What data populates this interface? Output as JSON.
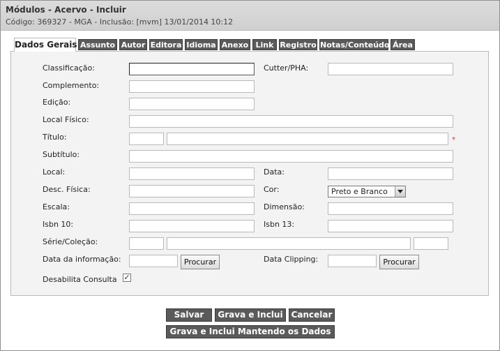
{
  "header": {
    "title": "Módulos - Acervo - Incluir",
    "subtitle": "Código: 369327 - MGA - Inclusão: [mvm] 13/01/2014 10:12"
  },
  "tabs": [
    {
      "label": "Dados Gerais",
      "active": true
    },
    {
      "label": "Assunto"
    },
    {
      "label": "Autor"
    },
    {
      "label": "Editora"
    },
    {
      "label": "Idioma"
    },
    {
      "label": "Anexo"
    },
    {
      "label": "Link"
    },
    {
      "label": "Registro"
    },
    {
      "label": "Notas/Conteúdo"
    },
    {
      "label": "Área"
    }
  ],
  "form": {
    "classificacao": {
      "label": "Classificação:",
      "value": ""
    },
    "cutter": {
      "label": "Cutter/PHA:",
      "value": ""
    },
    "complemento": {
      "label": "Complemento:",
      "value": ""
    },
    "edicao": {
      "label": "Edição:",
      "value": ""
    },
    "local_fisico": {
      "label": "Local Físico:",
      "value": ""
    },
    "titulo": {
      "label": "Título:",
      "value_prefix": "",
      "value": "",
      "required_mark": "*"
    },
    "subtitulo": {
      "label": "Subtítulo:",
      "value": ""
    },
    "local": {
      "label": "Local:",
      "value": ""
    },
    "data": {
      "label": "Data:",
      "value": ""
    },
    "desc_fisica": {
      "label": "Desc. Física:",
      "value": ""
    },
    "cor": {
      "label": "Cor:",
      "selected": "Preto e Branco"
    },
    "escala": {
      "label": "Escala:",
      "value": ""
    },
    "dimensao": {
      "label": "Dimensão:",
      "value": ""
    },
    "isbn10": {
      "label": "Isbn 10:",
      "value": ""
    },
    "isbn13": {
      "label": "Isbn 13:",
      "value": ""
    },
    "serie": {
      "label": "Série/Coleção:",
      "value_a": "",
      "value_b": "",
      "value_c": ""
    },
    "data_informacao": {
      "label": "Data da informação:",
      "value": "",
      "button": "Procurar"
    },
    "data_clipping": {
      "label": "Data Clipping:",
      "value": "",
      "button": "Procurar"
    },
    "desabilita": {
      "label": "Desabilita Consulta",
      "checked": true,
      "check_glyph": "✓"
    }
  },
  "actions": {
    "salvar": "Salvar",
    "grava_inclui": "Grava e Inclui",
    "cancelar": "Cancelar",
    "grava_mantendo": "Grava e Inclui Mantendo os Dados"
  }
}
